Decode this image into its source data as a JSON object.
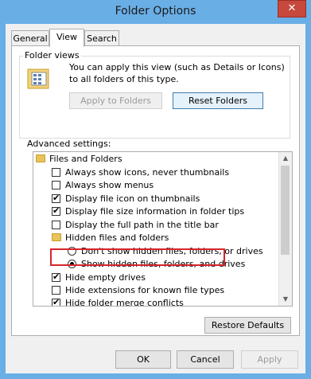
{
  "window": {
    "title": "Folder Options",
    "close_glyph": "✕"
  },
  "tabs": [
    {
      "label": "General",
      "active": false
    },
    {
      "label": "View",
      "active": true
    },
    {
      "label": "Search",
      "active": false
    }
  ],
  "folder_views": {
    "label": "Folder views",
    "description": "You can apply this view (such as Details or Icons) to all folders of this type.",
    "apply_button": "Apply to Folders",
    "reset_button": "Reset Folders"
  },
  "advanced": {
    "label": "Advanced settings:",
    "items": [
      {
        "type": "folder",
        "label": "Files and Folders",
        "indent": 0
      },
      {
        "type": "checkbox",
        "label": "Always show icons, never thumbnails",
        "checked": false,
        "indent": 1
      },
      {
        "type": "checkbox",
        "label": "Always show menus",
        "checked": false,
        "indent": 1
      },
      {
        "type": "checkbox",
        "label": "Display file icon on thumbnails",
        "checked": true,
        "indent": 1
      },
      {
        "type": "checkbox",
        "label": "Display file size information in folder tips",
        "checked": true,
        "indent": 1
      },
      {
        "type": "checkbox",
        "label": "Display the full path in the title bar",
        "checked": false,
        "indent": 1
      },
      {
        "type": "folder",
        "label": "Hidden files and folders",
        "indent": 1
      },
      {
        "type": "radio",
        "label": "Don't show hidden files, folders, or drives",
        "checked": false,
        "indent": 2
      },
      {
        "type": "radio",
        "label": "Show hidden files, folders, and drives",
        "checked": true,
        "indent": 2
      },
      {
        "type": "checkbox",
        "label": "Hide empty drives",
        "checked": true,
        "indent": 1
      },
      {
        "type": "checkbox",
        "label": "Hide extensions for known file types",
        "checked": false,
        "indent": 1
      },
      {
        "type": "checkbox",
        "label": "Hide folder merge conflicts",
        "checked": true,
        "indent": 1
      }
    ]
  },
  "restore_defaults": "Restore Defaults",
  "footer": {
    "ok": "OK",
    "cancel": "Cancel",
    "apply": "Apply"
  },
  "icons": {
    "scroll_up": "▲",
    "scroll_down": "▼"
  }
}
